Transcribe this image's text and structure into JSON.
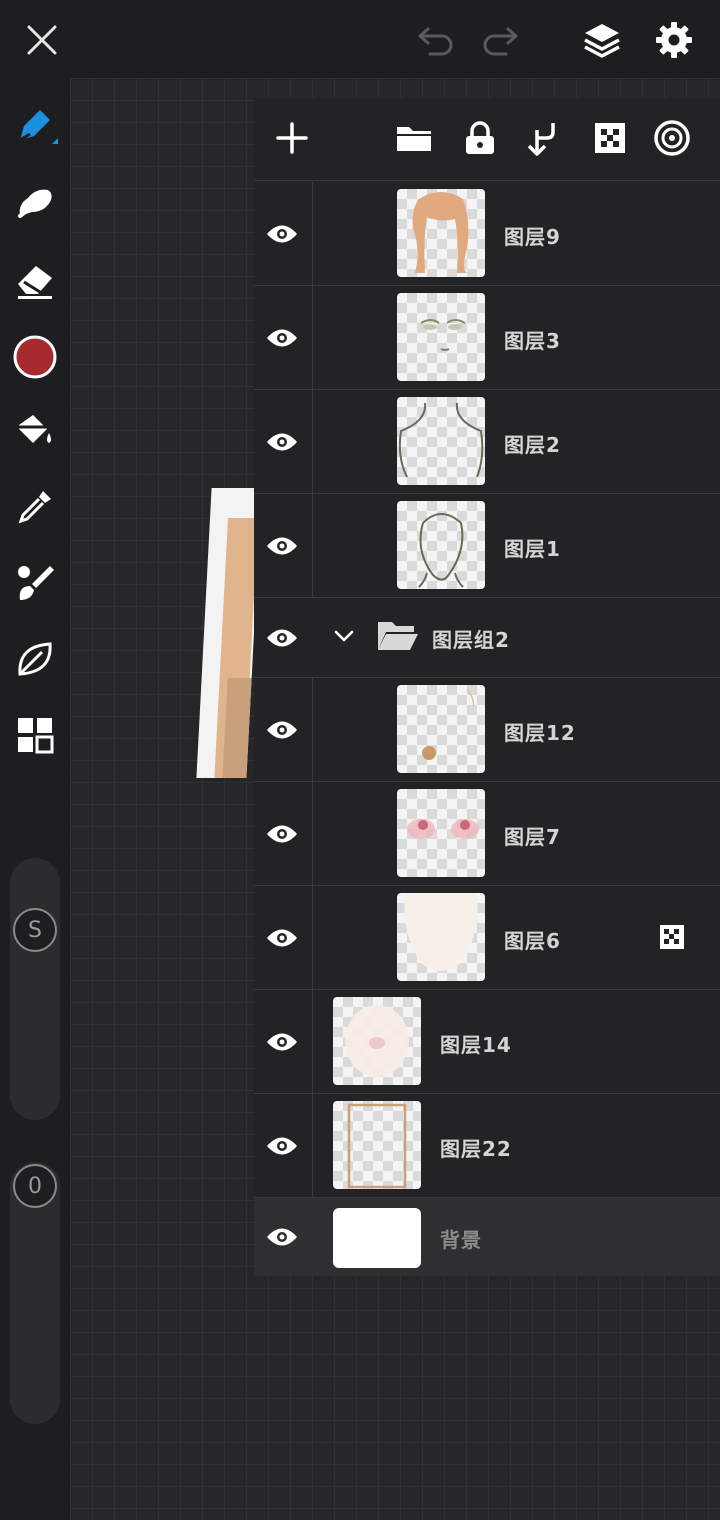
{
  "app": {
    "accent": "#1d8fe0",
    "current_color": "#a62b2e"
  },
  "topbar": {
    "icons": [
      "close-icon",
      "undo-icon",
      "redo-icon",
      "layers-icon",
      "settings-icon"
    ]
  },
  "sidebar": {
    "tools": [
      "pen-tool-icon",
      "smudge-icon",
      "eraser-icon",
      "color-swatch",
      "fill-bucket-icon",
      "eyedropper-icon",
      "brush-icon",
      "leaf-icon",
      "grid-icon"
    ],
    "size_slider_label": "S",
    "opacity_slider_label": "0"
  },
  "layers_panel": {
    "toolbar_icons": [
      "add-icon",
      "folder-icon",
      "lock-icon",
      "merge-down-icon",
      "checkerboard-icon",
      "target-icon"
    ],
    "layers": [
      {
        "name": "图层9",
        "visible": true,
        "indent": 1
      },
      {
        "name": "图层3",
        "visible": true,
        "indent": 1
      },
      {
        "name": "图层2",
        "visible": true,
        "indent": 1
      },
      {
        "name": "图层1",
        "visible": true,
        "indent": 1
      },
      {
        "name": "图层组2",
        "visible": true,
        "type": "group",
        "expanded": true
      },
      {
        "name": "图层12",
        "visible": true,
        "indent": 1
      },
      {
        "name": "图层7",
        "visible": true,
        "indent": 1
      },
      {
        "name": "图层6",
        "visible": true,
        "indent": 1,
        "has_mask_icon": true
      },
      {
        "name": "图层14",
        "visible": true,
        "indent": 0
      },
      {
        "name": "图层22",
        "visible": true,
        "indent": 0
      },
      {
        "name": "背景",
        "visible": true,
        "type": "background"
      }
    ]
  }
}
